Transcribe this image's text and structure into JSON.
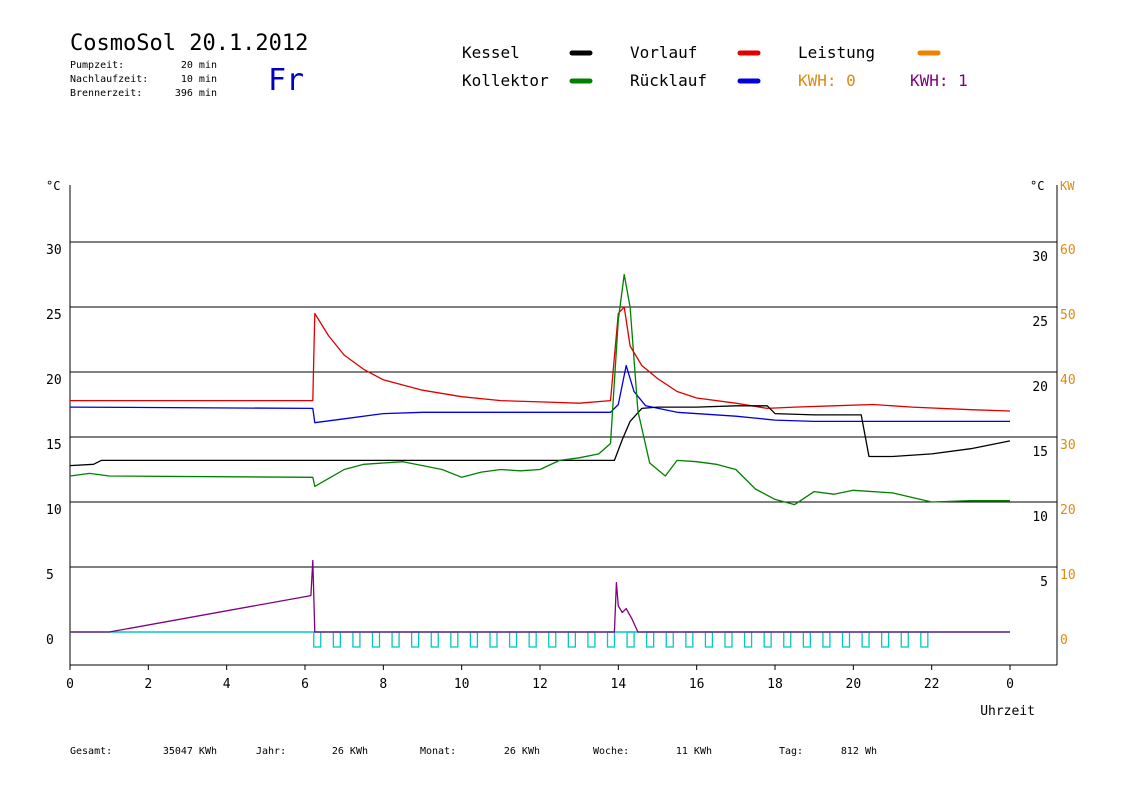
{
  "header": {
    "title": "CosmoSol 20.1.2012",
    "day": "Fr",
    "stats": [
      {
        "label": "Pumpzeit:",
        "value": "20 min"
      },
      {
        "label": "Nachlaufzeit:",
        "value": "10 min"
      },
      {
        "label": "Brennerzeit:",
        "value": "396 min"
      }
    ]
  },
  "legend": [
    {
      "label": "Kessel",
      "color": "#000000"
    },
    {
      "label": "Vorlauf",
      "color": "#e00000"
    },
    {
      "label": "Leistung",
      "color": "#f08000"
    },
    {
      "label": "Kollektor",
      "color": "#008000"
    },
    {
      "label": "Rücklauf",
      "color": "#0000e0"
    }
  ],
  "kwh_labels": [
    {
      "text": "KWH: 0",
      "color": "#e08a10"
    },
    {
      "text": "KWH: 1",
      "color": "#800080"
    }
  ],
  "footer": [
    {
      "label": "Gesamt:",
      "value": "35047 KWh"
    },
    {
      "label": "Jahr:",
      "value": "26 KWh"
    },
    {
      "label": "Monat:",
      "value": "26 KWh"
    },
    {
      "label": "Woche:",
      "value": "11 KWh"
    },
    {
      "label": "Tag:",
      "value": "812 Wh"
    }
  ],
  "chart_data": {
    "type": "line",
    "xlabel": "Uhrzeit",
    "ylabel_left": "°C",
    "ylabel_right_temp": "°C",
    "ylabel_right_power": "KW",
    "xlim": [
      0,
      24
    ],
    "ylim": [
      0,
      30
    ],
    "ylim_power": [
      0,
      60
    ],
    "x_ticks": [
      0,
      2,
      4,
      6,
      8,
      10,
      12,
      14,
      16,
      18,
      20,
      22,
      24
    ],
    "x_tick_labels": [
      "0",
      "2",
      "4",
      "6",
      "8",
      "10",
      "12",
      "14",
      "16",
      "18",
      "20",
      "22",
      "0"
    ],
    "y_ticks_left": [
      "0",
      "5",
      "10",
      "15",
      "20",
      "25",
      "30"
    ],
    "y_ticks_right_temp": [
      "5",
      "10",
      "15",
      "20",
      "25",
      "30"
    ],
    "y_ticks_right_power": [
      "0",
      "10",
      "20",
      "30",
      "40",
      "50",
      "60"
    ],
    "gridlines_y": [
      5,
      10,
      15,
      20,
      25,
      30
    ],
    "series": [
      {
        "name": "Vorlauf",
        "color": "#e00000",
        "points": [
          [
            0,
            17.8
          ],
          [
            6.2,
            17.8
          ],
          [
            6.25,
            24.5
          ],
          [
            6.6,
            22.8
          ],
          [
            7,
            21.3
          ],
          [
            7.5,
            20.2
          ],
          [
            8,
            19.4
          ],
          [
            9,
            18.6
          ],
          [
            10,
            18.1
          ],
          [
            11,
            17.8
          ],
          [
            12,
            17.7
          ],
          [
            13,
            17.6
          ],
          [
            13.8,
            17.8
          ],
          [
            14,
            24.5
          ],
          [
            14.15,
            25
          ],
          [
            14.3,
            22
          ],
          [
            14.6,
            20.5
          ],
          [
            15,
            19.5
          ],
          [
            15.5,
            18.5
          ],
          [
            16,
            18
          ],
          [
            17,
            17.6
          ],
          [
            17.8,
            17.2
          ],
          [
            18.5,
            17.3
          ],
          [
            19.5,
            17.4
          ],
          [
            20.5,
            17.5
          ],
          [
            21.5,
            17.3
          ],
          [
            23,
            17.1
          ],
          [
            24,
            17
          ]
        ]
      },
      {
        "name": "Rücklauf",
        "color": "#0000e0",
        "points": [
          [
            0,
            17.3
          ],
          [
            6.2,
            17.2
          ],
          [
            6.25,
            16.1
          ],
          [
            7,
            16.4
          ],
          [
            8,
            16.8
          ],
          [
            9,
            16.9
          ],
          [
            10,
            16.9
          ],
          [
            11,
            16.9
          ],
          [
            12,
            16.9
          ],
          [
            13,
            16.9
          ],
          [
            13.8,
            16.9
          ],
          [
            14,
            17.5
          ],
          [
            14.2,
            20.5
          ],
          [
            14.4,
            18.5
          ],
          [
            14.7,
            17.4
          ],
          [
            15.5,
            16.9
          ],
          [
            17,
            16.6
          ],
          [
            18,
            16.3
          ],
          [
            19,
            16.2
          ],
          [
            20,
            16.2
          ],
          [
            21,
            16.2
          ],
          [
            22,
            16.2
          ],
          [
            24,
            16.2
          ]
        ]
      },
      {
        "name": "Kessel",
        "color": "#000000",
        "points": [
          [
            0,
            12.8
          ],
          [
            0.6,
            12.9
          ],
          [
            0.8,
            13.2
          ],
          [
            6.2,
            13.2
          ],
          [
            6.3,
            13.2
          ],
          [
            9,
            13.2
          ],
          [
            12,
            13.2
          ],
          [
            13.9,
            13.2
          ],
          [
            14.1,
            14.8
          ],
          [
            14.3,
            16.2
          ],
          [
            14.6,
            17.2
          ],
          [
            15,
            17.3
          ],
          [
            16,
            17.3
          ],
          [
            17,
            17.4
          ],
          [
            17.8,
            17.4
          ],
          [
            18,
            16.8
          ],
          [
            19,
            16.7
          ],
          [
            20.2,
            16.7
          ],
          [
            20.4,
            13.5
          ],
          [
            21,
            13.5
          ],
          [
            22,
            13.7
          ],
          [
            23,
            14.1
          ],
          [
            24,
            14.7
          ]
        ]
      },
      {
        "name": "Kollektor",
        "color": "#008000",
        "points": [
          [
            0,
            12
          ],
          [
            0.5,
            12.2
          ],
          [
            1,
            12
          ],
          [
            6.2,
            11.9
          ],
          [
            6.25,
            11.2
          ],
          [
            6.6,
            11.8
          ],
          [
            7,
            12.5
          ],
          [
            7.5,
            12.9
          ],
          [
            8,
            13
          ],
          [
            8.5,
            13.1
          ],
          [
            9,
            12.8
          ],
          [
            9.5,
            12.5
          ],
          [
            10,
            11.9
          ],
          [
            10.5,
            12.3
          ],
          [
            11,
            12.5
          ],
          [
            11.5,
            12.4
          ],
          [
            12,
            12.5
          ],
          [
            12.5,
            13.2
          ],
          [
            13,
            13.4
          ],
          [
            13.5,
            13.7
          ],
          [
            13.8,
            14.5
          ],
          [
            14,
            24
          ],
          [
            14.15,
            27.5
          ],
          [
            14.3,
            25
          ],
          [
            14.5,
            17
          ],
          [
            14.8,
            13
          ],
          [
            15.2,
            12
          ],
          [
            15.5,
            13.2
          ],
          [
            16,
            13.1
          ],
          [
            16.5,
            12.9
          ],
          [
            17,
            12.5
          ],
          [
            17.5,
            11
          ],
          [
            18,
            10.2
          ],
          [
            18.5,
            9.8
          ],
          [
            19,
            10.8
          ],
          [
            19.5,
            10.6
          ],
          [
            20,
            10.9
          ],
          [
            21,
            10.7
          ],
          [
            22,
            10
          ],
          [
            23,
            10.1
          ],
          [
            24,
            10.1
          ]
        ]
      },
      {
        "name": "Leistung",
        "color": "#800080",
        "points": [
          [
            0,
            0
          ],
          [
            1,
            0
          ],
          [
            6.15,
            2.8
          ],
          [
            6.2,
            5.5
          ],
          [
            6.25,
            0
          ],
          [
            13.9,
            0
          ],
          [
            13.95,
            3.8
          ],
          [
            14,
            2
          ],
          [
            14.1,
            1.5
          ],
          [
            14.2,
            1.8
          ],
          [
            14.35,
            1
          ],
          [
            14.5,
            0
          ],
          [
            24,
            0
          ]
        ]
      }
    ],
    "pump_markers_hours": [
      6.3,
      6.8,
      7.3,
      7.8,
      8.3,
      8.8,
      9.3,
      9.8,
      10.3,
      10.8,
      11.3,
      11.8,
      12.3,
      12.8,
      13.3,
      13.8,
      14.3,
      14.8,
      15.3,
      15.8,
      16.3,
      16.8,
      17.3,
      17.8,
      18.3,
      18.8,
      19.3,
      19.8,
      20.3,
      20.8,
      21.3,
      21.8
    ],
    "baseline_color": "#00c8c8"
  }
}
